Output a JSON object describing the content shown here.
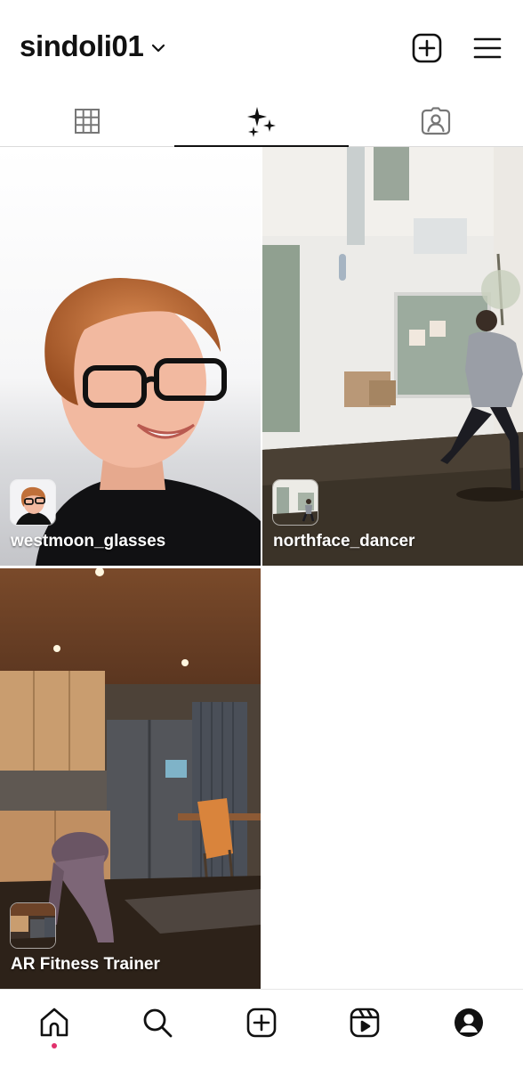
{
  "header": {
    "username": "sindoli01",
    "icons": {
      "username_dropdown": "chevron-down-icon",
      "new_post": "plus-square-icon",
      "menu": "hamburger-icon"
    }
  },
  "tabs": [
    {
      "icon": "grid-icon",
      "active": false
    },
    {
      "icon": "sparkles-icon",
      "active": true
    },
    {
      "icon": "tagged-person-icon",
      "active": false
    }
  ],
  "effects": [
    {
      "name": "westmoon_glasses"
    },
    {
      "name": "northface_dancer"
    },
    {
      "name": "AR Fitness Trainer"
    }
  ],
  "bottom_nav": {
    "items": [
      "home-icon",
      "search-icon",
      "create-icon",
      "reels-icon",
      "profile-icon"
    ],
    "active": "home-icon",
    "notification_color": "#e1306c"
  }
}
